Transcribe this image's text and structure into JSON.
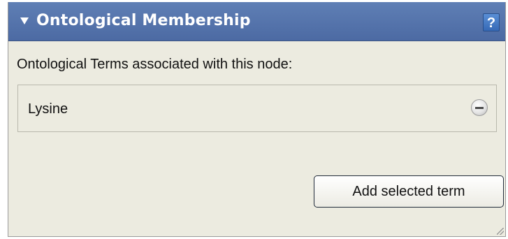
{
  "panel": {
    "title": "Ontological Membership",
    "collapse_icon": "triangle-down-icon",
    "help_label": "?",
    "intro_text": "Ontological Terms associated with this node:",
    "terms": [
      {
        "label": "Lysine",
        "remove_icon": "minus-circle-icon"
      }
    ],
    "add_button_label": "Add selected term"
  },
  "colors": {
    "header": "#5375ad",
    "panel_bg": "#ecebe0",
    "help_button": "#4a7fc9"
  }
}
